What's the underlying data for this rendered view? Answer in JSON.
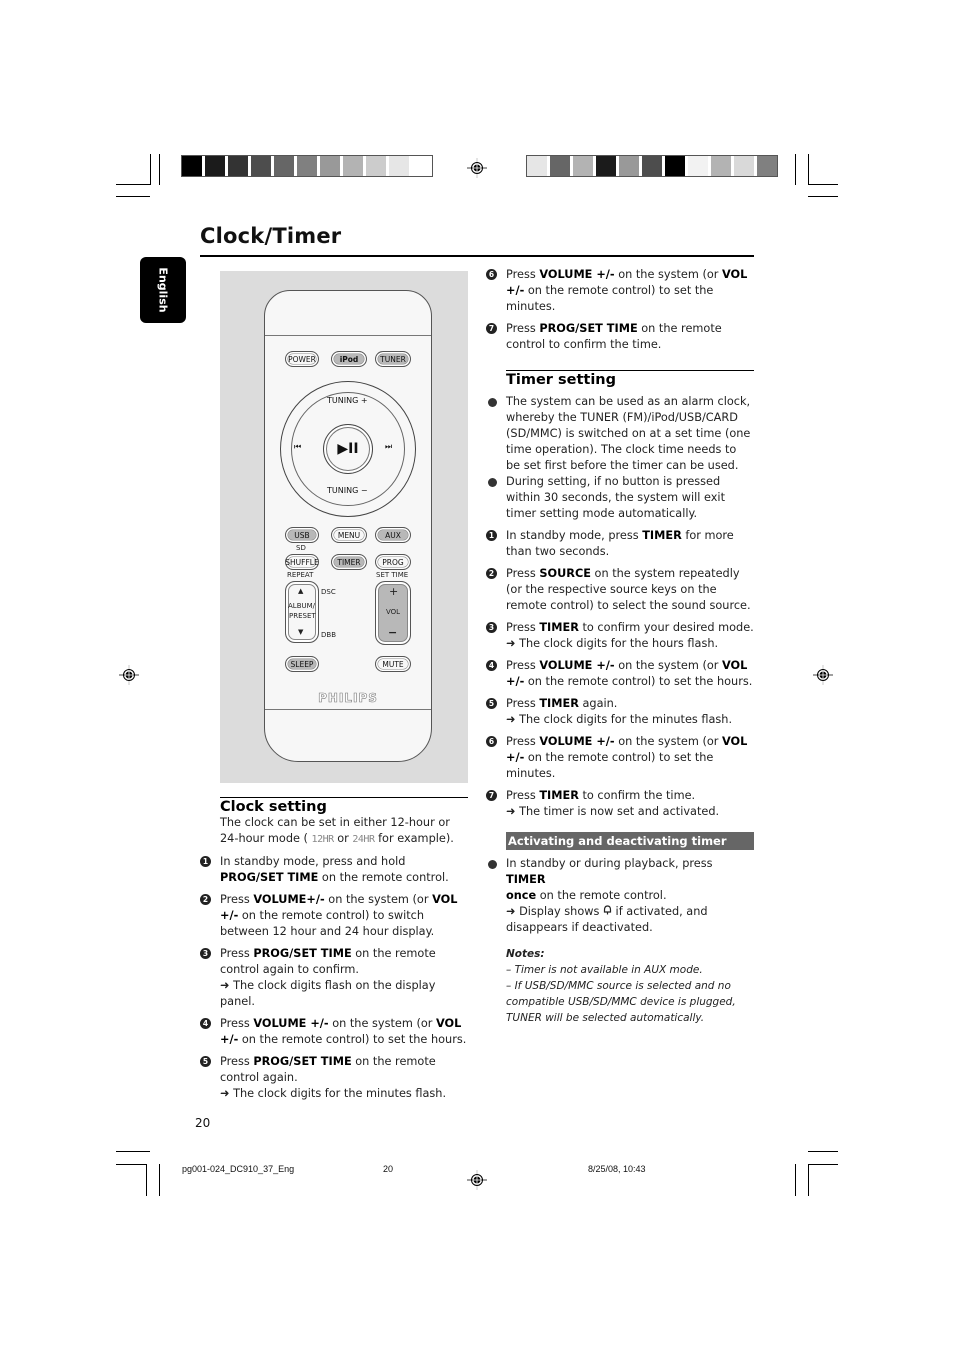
{
  "page": {
    "title": "Clock/Timer",
    "language_tab": "English",
    "page_number": "20"
  },
  "print_marks": {
    "swatches_left": [
      "#000000",
      "#1b1b1b",
      "#333333",
      "#4d4d4d",
      "#666666",
      "#808080",
      "#999999",
      "#b3b3b3",
      "#cccccc",
      "#e6e6e6",
      "#ffffff"
    ],
    "swatches_right": [
      "#e6e6e6",
      "#666666",
      "#b3b3b3",
      "#1b1b1b",
      "#999999",
      "#4d4d4d",
      "#000000",
      "#f2f2f2",
      "#b3b3b3",
      "#d9d9d9",
      "#808080"
    ]
  },
  "remote": {
    "row1": [
      "POWER",
      "iPod",
      "TUNER"
    ],
    "tuning_up": "TUNING +",
    "tuning_down": "TUNING −",
    "prev": "⏮",
    "next": "⏭",
    "play_pause": "▶II",
    "row2": [
      "USB",
      "MENU",
      "AUX"
    ],
    "sd_label": "SD",
    "row3": [
      "SHUFFLE",
      "TIMER",
      "PROG"
    ],
    "repeat_label": "REPEAT",
    "set_time_label": "SET TIME",
    "album_up": "▲",
    "album_label_1": "ALBUM/",
    "album_label_2": "PRESET",
    "album_down": "▼",
    "dsc_label": "DSC",
    "dbb_label": "DBB",
    "vol_plus": "+",
    "vol_label": "VOL",
    "vol_minus": "−",
    "sleep": "SLEEP",
    "mute": "MUTE",
    "brand": "PHILIPS"
  },
  "clock_setting": {
    "heading": "Clock setting",
    "intro_1": "The clock can be set in either 12-hour or",
    "intro_2a": "24-hour mode ( ",
    "lcd_12": "12HR",
    "intro_2b": " or ",
    "lcd_24": "24HR",
    "intro_2c": " for example).",
    "steps": [
      {
        "n": "1",
        "pre": "In standby mode, press and hold ",
        "bold": "PROG/SET TIME",
        "post": " on the remote control.",
        "result": ""
      },
      {
        "n": "2",
        "pre": "Press ",
        "bold": "VOLUME+/-",
        "post": " on the system (or ",
        "bold2": "VOL  +/-",
        "post2": " on the remote control) to switch between 12 hour and 24 hour display.",
        "result": ""
      },
      {
        "n": "3",
        "pre": "Press ",
        "bold": "PROG/SET TIME",
        "post": " on the remote control again to confirm.",
        "result": "The clock digits flash on the display panel."
      },
      {
        "n": "4",
        "pre": "Press ",
        "bold": "VOLUME +/-",
        "post": " on the system (or ",
        "bold2": "VOL  +/-",
        "post2": " on the remote control) to set the hours.",
        "result": ""
      },
      {
        "n": "5",
        "pre": "Press ",
        "bold": "PROG/SET TIME",
        "post": " on the remote control again.",
        "result": "The clock digits for the minutes flash."
      },
      {
        "n": "6",
        "pre": "Press ",
        "bold": "VOLUME +/-",
        "post": " on the system (or ",
        "bold2": "VOL  +/-",
        "post2": " on the remote control) to set the minutes.",
        "result": ""
      },
      {
        "n": "7",
        "pre": "Press ",
        "bold": "PROG/SET TIME",
        "post": "  on the remote control to confirm the time.",
        "result": ""
      }
    ]
  },
  "timer_setting": {
    "heading": "Timer setting",
    "bullets": [
      "The system can be used as an alarm clock, whereby the TUNER (FM)/iPod/USB/CARD (SD/MMC) is switched on at a set time (one time operation). The clock time needs to be set first before the timer can be used.",
      "During setting, if no button is pressed within 30 seconds, the system will exit timer setting mode automatically."
    ],
    "steps": [
      {
        "n": "1",
        "pre": "In standby mode, press ",
        "bold": "TIMER",
        "post": " for more than two seconds.",
        "result": ""
      },
      {
        "n": "2",
        "pre": "Press ",
        "bold": "SOURCE",
        "post": " on the system repeatedly (or the respective source keys on the remote control) to select the sound source.",
        "result": ""
      },
      {
        "n": "3",
        "pre": "Press ",
        "bold": "TIMER",
        "post": " to confirm your desired mode.",
        "result": "The clock digits for the hours flash."
      },
      {
        "n": "4",
        "pre": "Press ",
        "bold": "VOLUME +/-",
        "post": " on the system (or ",
        "bold2": "VOL  +/-",
        "post2": " on the remote control) to set the hours.",
        "result": ""
      },
      {
        "n": "5",
        "pre": "Press ",
        "bold": "TIMER",
        "post": " again.",
        "result": "The clock digits for the minutes flash."
      },
      {
        "n": "6",
        "pre": "Press ",
        "bold": "VOLUME +/-",
        "post": " on the system (or ",
        "bold2": "VOL  +/-",
        "post2": " on the remote control) to set the minutes.",
        "result": ""
      },
      {
        "n": "7",
        "pre": "Press ",
        "bold": "TIMER",
        "post": " to confirm the time.",
        "result": "The timer is now set and activated."
      }
    ]
  },
  "activating": {
    "heading": "Activating and deactivating timer",
    "bullet_pre": "In standby or during playback, press ",
    "bullet_bold": "TIMER",
    "bullet_bold2": "once",
    "bullet_post": " on the remote control.",
    "result_pre": "Display shows ",
    "result_icon": "alarm-bell",
    "result_post": " if activated, and disappears if deactivated.",
    "notes_title": "Notes:",
    "notes": [
      "–  Timer is not available in  AUX mode.",
      "–  If USB/SD/MMC source is selected and no compatible USB/SD/MMC device is plugged, TUNER will be selected automatically."
    ]
  },
  "footer": {
    "file": "pg001-024_DC910_37_Eng",
    "page": "20",
    "datetime": "8/25/08, 10:43"
  }
}
